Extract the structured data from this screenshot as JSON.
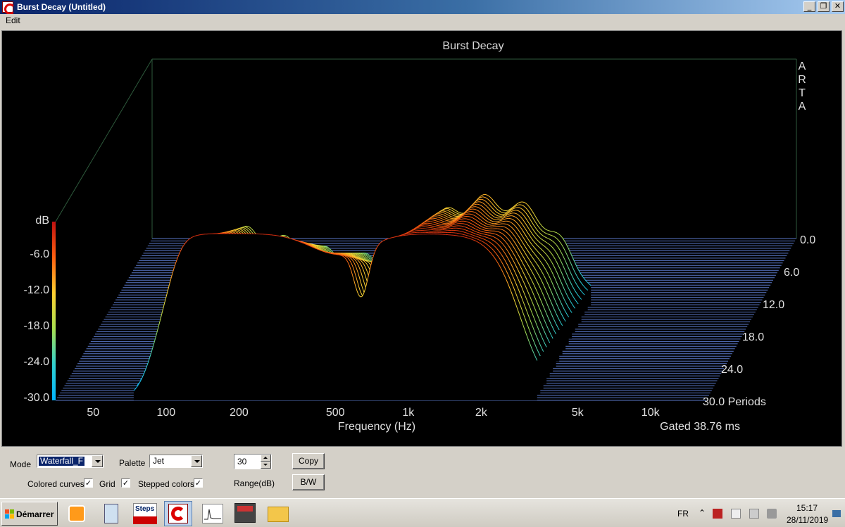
{
  "window": {
    "title": "Burst Decay  (Untitled)",
    "minimize": "_",
    "restore": "❐",
    "close": "✕"
  },
  "menu": {
    "edit": "Edit"
  },
  "chart_data": {
    "type": "waterfall",
    "title": "Burst Decay",
    "brand_letters": [
      "A",
      "R",
      "T",
      "A"
    ],
    "xlabel": "Frequency (Hz)",
    "x_scale": "log",
    "x_ticks": [
      {
        "value": 50,
        "label": "50"
      },
      {
        "value": 100,
        "label": "100"
      },
      {
        "value": 200,
        "label": "200"
      },
      {
        "value": 500,
        "label": "500"
      },
      {
        "value": 1000,
        "label": "1k"
      },
      {
        "value": 2000,
        "label": "2k"
      },
      {
        "value": 5000,
        "label": "5k"
      },
      {
        "value": 10000,
        "label": "10k"
      }
    ],
    "ylabel": "dB",
    "y_ticks": [
      "-6.0",
      "-12.0",
      "-18.0",
      "-24.0",
      "-30.0"
    ],
    "z_ticks": [
      "0.0",
      "6.0",
      "12.0",
      "18.0",
      "24.0",
      "30.0 Periods"
    ],
    "gated_text": "Gated 38.76 ms",
    "db_range": [
      -30,
      0
    ],
    "periods_range": [
      0,
      30
    ],
    "palette": "Jet"
  },
  "controls": {
    "mode_label": "Mode",
    "mode_value": "Waterfall_F",
    "palette_label": "Palette",
    "palette_value": "Jet",
    "range_value": "30",
    "range_label": "Range(dB)",
    "copy_button": "Copy",
    "bw_button": "B/W",
    "colored_curves_label": "Colored curves",
    "colored_curves_checked": "✓",
    "grid_label": "Grid",
    "grid_checked": "✓",
    "stepped_colors_label": "Stepped colors",
    "stepped_colors_checked": "✓"
  },
  "taskbar": {
    "start_label": "Démarrer",
    "steps_label": "Steps",
    "language": "FR",
    "time": "15:17",
    "date": "28/11/2019",
    "tray_chevron": "⌃"
  }
}
